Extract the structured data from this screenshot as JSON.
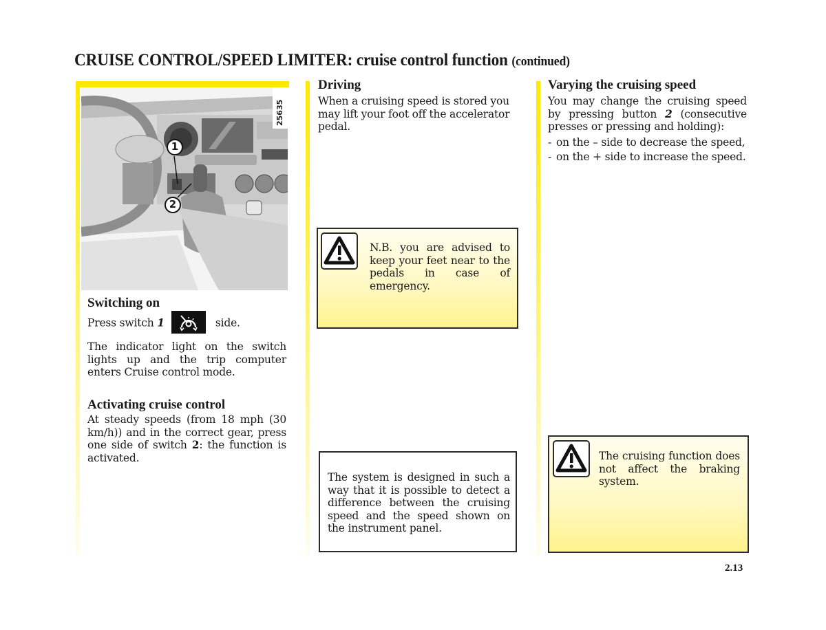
{
  "page": {
    "title_main": "CRUISE CONTROL/SPEED LIMITER: cruise control function",
    "title_continued": "(continued)",
    "page_number": "2.13"
  },
  "figure": {
    "reference_code": "25635",
    "callouts": [
      "1",
      "2"
    ]
  },
  "column1": {
    "switching_on": {
      "heading": "Switching on",
      "line_prefix": "Press switch ",
      "switch_number": "1",
      "icon": "cruise-control-speedometer-icon",
      "line_suffix": "side.",
      "body": "The indicator light on the switch lights up and the trip computer enters Cruise control mode."
    },
    "activating": {
      "heading": "Activating cruise control",
      "body_prefix": "At steady speeds (from 18 mph (30 km/h)) and in the correct gear, press one side of switch ",
      "switch_number": "2",
      "body_suffix": ": the function is activated."
    }
  },
  "column2": {
    "driving": {
      "heading": "Driving",
      "body": "When a cruising speed is stored you may lift your foot off the accelerator pedal."
    },
    "warning_box": {
      "icon": "warning-triangle-icon",
      "text": "N.B. you are advised to keep your feet near to the pedals in case of emergency."
    },
    "note_box": {
      "text": "The system is designed in such a way that it is possible to detect a difference between the cruising speed and the speed shown on the instrument panel."
    }
  },
  "column3": {
    "varying": {
      "heading": "Varying the cruising speed",
      "body_prefix": "You may change the cruising speed by pressing button ",
      "button_number": "2",
      "body_suffix": " (consecutive presses or pressing and holding):",
      "items": [
        "on the – side to decrease the speed,",
        "on the + side to increase the speed."
      ]
    },
    "warning_box": {
      "icon": "warning-triangle-icon",
      "text": "The cruising function does not affect the braking system."
    }
  },
  "colors": {
    "accent_yellow": "#ffe800",
    "border": "#2a2a2a"
  }
}
